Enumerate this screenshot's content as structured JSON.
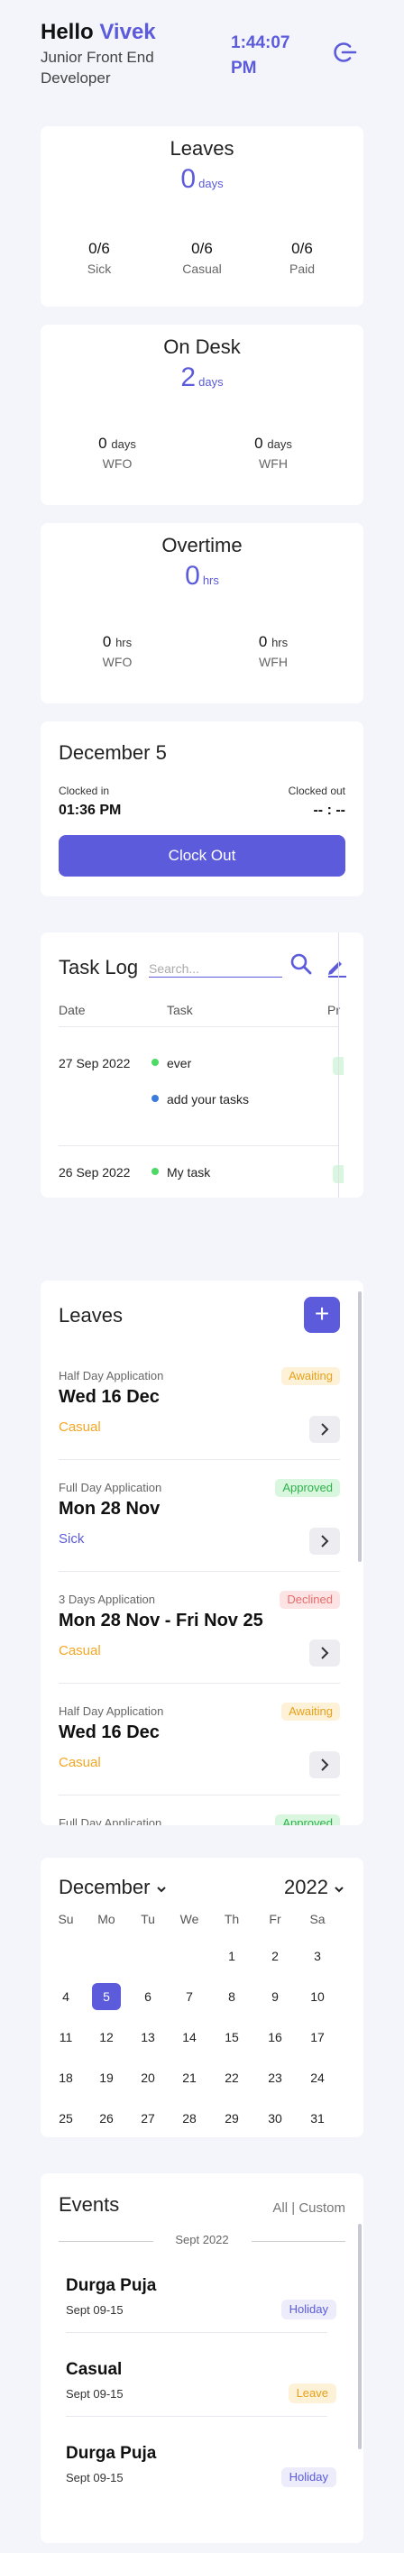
{
  "header": {
    "hello": "Hello",
    "name": "Vivek",
    "role": "Junior Front End Developer",
    "time": "1:44:07 PM"
  },
  "leaves_card": {
    "title": "Leaves",
    "total": "0",
    "unit": "days",
    "items": [
      {
        "value": "0/6",
        "label": "Sick"
      },
      {
        "value": "0/6",
        "label": "Casual"
      },
      {
        "value": "0/6",
        "label": "Paid"
      }
    ]
  },
  "ondesk_card": {
    "title": "On Desk",
    "total": "2",
    "unit": "days",
    "items": [
      {
        "value": "0",
        "unit": "days",
        "label": "WFO"
      },
      {
        "value": "0",
        "unit": "days",
        "label": "WFH"
      }
    ]
  },
  "overtime_card": {
    "title": "Overtime",
    "total": "0",
    "unit": "hrs",
    "items": [
      {
        "value": "0",
        "unit": "hrs",
        "label": "WFO"
      },
      {
        "value": "0",
        "unit": "hrs",
        "label": "WFH"
      }
    ]
  },
  "clock": {
    "date": "December 5",
    "in_label": "Clocked in",
    "in_value": "01:36 PM",
    "out_label": "Clocked out",
    "out_value": "-- : --",
    "button": "Clock Out"
  },
  "task_log": {
    "title": "Task Log",
    "search_placeholder": "Search...",
    "headers": [
      "Date",
      "Task",
      "Pr"
    ],
    "rows": [
      {
        "date": "27 Sep 2022",
        "tasks": [
          {
            "text": "ever",
            "color": "#4cd964"
          },
          {
            "text": "add your tasks",
            "color": "#3b7bdc"
          }
        ]
      },
      {
        "date": "26 Sep 2022",
        "tasks": [
          {
            "text": "My task",
            "color": "#4cd964"
          }
        ]
      }
    ]
  },
  "leaves_list": {
    "title": "Leaves",
    "add": "+",
    "items": [
      {
        "type": "Half Day Application",
        "date": "Wed 16 Dec",
        "kind": "Casual",
        "kind_color": "#f5a623",
        "status": "Awaiting",
        "status_bg": "#fdf1d8",
        "status_color": "#e5a21a"
      },
      {
        "type": "Full Day Application",
        "date": "Mon 28 Nov",
        "kind": "Sick",
        "kind_color": "#5b5bdc",
        "status": "Approved",
        "status_bg": "#d9f7de",
        "status_color": "#2fb14d"
      },
      {
        "type": "3 Days Application",
        "date": "Mon 28 Nov - Fri Nov 25",
        "kind": "Casual",
        "kind_color": "#f5a623",
        "status": "Declined",
        "status_bg": "#fde4e4",
        "status_color": "#e86b6b"
      },
      {
        "type": "Half Day Application",
        "date": "Wed 16 Dec",
        "kind": "Casual",
        "kind_color": "#f5a623",
        "status": "Awaiting",
        "status_bg": "#fdf1d8",
        "status_color": "#e5a21a"
      },
      {
        "type": "Full Day Application",
        "date": "",
        "kind": "",
        "kind_color": "#5b5bdc",
        "status": "Approved",
        "status_bg": "#d9f7de",
        "status_color": "#2fb14d"
      }
    ]
  },
  "calendar": {
    "month": "December",
    "year": "2022",
    "weekdays": [
      "Su",
      "Mo",
      "Tu",
      "We",
      "Th",
      "Fr",
      "Sa"
    ],
    "weeks": [
      [
        "",
        "",
        "",
        "",
        "1",
        "2",
        "3"
      ],
      [
        "4",
        "5",
        "6",
        "7",
        "8",
        "9",
        "10"
      ],
      [
        "11",
        "12",
        "13",
        "14",
        "15",
        "16",
        "17"
      ],
      [
        "18",
        "19",
        "20",
        "21",
        "22",
        "23",
        "24"
      ],
      [
        "25",
        "26",
        "27",
        "28",
        "29",
        "30",
        "31"
      ]
    ],
    "selected": "5"
  },
  "events": {
    "title": "Events",
    "filter_all": "All",
    "filter_sep": "|",
    "filter_custom": "Custom",
    "group": "Sept 2022",
    "items": [
      {
        "name": "Durga Puja",
        "date": "Sept 09-15",
        "badge": "Holiday",
        "badge_bg": "#ececfb",
        "badge_color": "#5b5bdc"
      },
      {
        "name": "Casual",
        "date": "Sept 09-15",
        "badge": "Leave",
        "badge_bg": "#fdf1d8",
        "badge_color": "#e5a21a"
      },
      {
        "name": "Durga Puja",
        "date": "Sept 09-15",
        "badge": "Holiday",
        "badge_bg": "#ececfb",
        "badge_color": "#5b5bdc"
      }
    ]
  }
}
